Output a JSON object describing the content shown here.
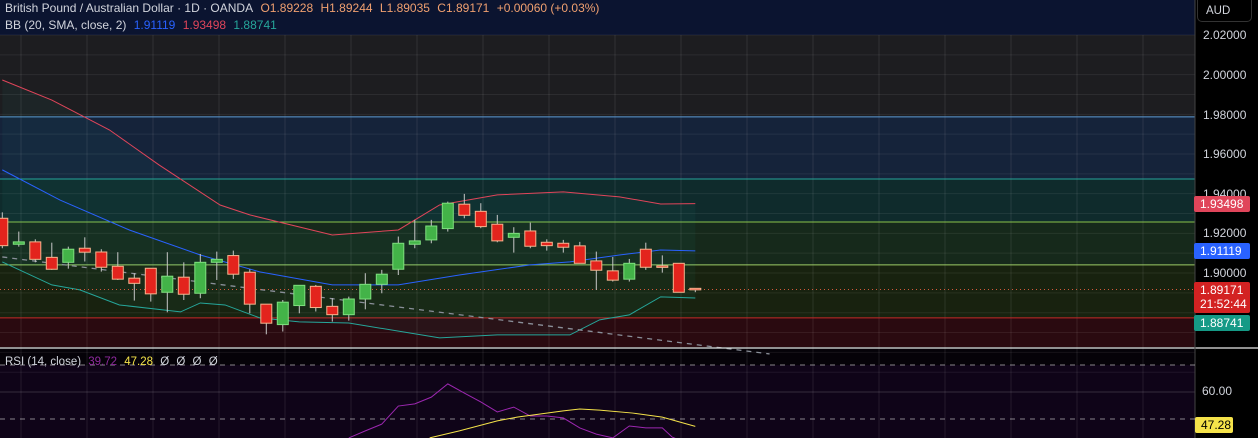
{
  "header": {
    "symbol": "British Pound / Australian Dollar · 1D · OANDA",
    "open": "O1.89228",
    "high": "H1.89244",
    "low": "L1.89035",
    "close": "C1.89171",
    "change": "+0.00060 (+0.03%)"
  },
  "bb_legend": {
    "label": "BB (20, SMA, close, 2)",
    "basis": "1.91119",
    "upper": "1.93498",
    "lower": "1.88741"
  },
  "rsi_legend": {
    "label": "RSI (14, close)",
    "rsi": "39.72",
    "ma": "47.28",
    "extra": [
      "Ø",
      "Ø",
      "Ø",
      "Ø"
    ]
  },
  "axis": {
    "currency": "AUD",
    "ticks": [
      "2.02000",
      "2.00000",
      "1.98000",
      "1.96000",
      "1.94000",
      "1.92000",
      "1.90000"
    ],
    "tick_values": [
      2.02,
      2.0,
      1.98,
      1.96,
      1.94,
      1.92,
      1.9
    ],
    "upper_tag": "1.93498",
    "basis_tag": "1.91119",
    "price_tag": "1.89171",
    "countdown": "21:52:44",
    "lower_tag": "1.88741",
    "rsi_tick": "60.00",
    "rsi_tag": "47.28"
  },
  "colors": {
    "up": "#43b348",
    "down": "#e3241d",
    "upper": "#e0455a",
    "basis": "#2962ff",
    "lower": "#26a69a",
    "rsi": "#9c27b0",
    "rsi_ma": "#f5e34a"
  },
  "chart_data": {
    "type": "candlestick",
    "price_range": [
      1.8435,
      2.0305
    ],
    "current_price": 1.89171,
    "levels": [
      1.9787,
      1.9474,
      1.9257,
      1.9041,
      1.8774
    ],
    "ohlc": [
      [
        1.9276,
        1.9306,
        1.9125,
        1.9138
      ],
      [
        1.9145,
        1.9209,
        1.9133,
        1.9157
      ],
      [
        1.9157,
        1.917,
        1.9054,
        1.9069
      ],
      [
        1.9079,
        1.9153,
        1.9016,
        1.9019
      ],
      [
        1.9054,
        1.9133,
        1.9022,
        1.912
      ],
      [
        1.9125,
        1.918,
        1.9058,
        1.9105
      ],
      [
        1.9106,
        1.912,
        1.9007,
        1.9029
      ],
      [
        1.9034,
        1.9105,
        1.8965,
        1.8969
      ],
      [
        1.8974,
        1.8999,
        1.8861,
        1.8948
      ],
      [
        1.9024,
        1.9024,
        1.8856,
        1.8895
      ],
      [
        1.8903,
        1.9105,
        1.8802,
        1.8984
      ],
      [
        1.8979,
        1.9054,
        1.8864,
        1.8893
      ],
      [
        1.8898,
        1.9096,
        1.8873,
        1.9054
      ],
      [
        1.9054,
        1.9108,
        1.8965,
        1.9069
      ],
      [
        1.9088,
        1.9113,
        1.897,
        1.8994
      ],
      [
        1.9004,
        1.9019,
        1.8797,
        1.8843
      ],
      [
        1.8843,
        1.8843,
        1.8691,
        1.8747
      ],
      [
        1.874,
        1.8864,
        1.8705,
        1.8853
      ],
      [
        1.8836,
        1.8938,
        1.8797,
        1.8938
      ],
      [
        1.8933,
        1.894,
        1.8806,
        1.8826
      ],
      [
        1.8832,
        1.8873,
        1.8755,
        1.879
      ],
      [
        1.879,
        1.8881,
        1.876,
        1.8869
      ],
      [
        1.8869,
        1.8999,
        1.8817,
        1.8943
      ],
      [
        1.8943,
        1.9016,
        1.8898,
        1.8994
      ],
      [
        1.9019,
        1.9184,
        1.899,
        1.915
      ],
      [
        1.9145,
        1.9268,
        1.9125,
        1.9162
      ],
      [
        1.9167,
        1.9268,
        1.915,
        1.9237
      ],
      [
        1.9224,
        1.936,
        1.9209,
        1.9352
      ],
      [
        1.9347,
        1.9399,
        1.9276,
        1.9291
      ],
      [
        1.9311,
        1.9352,
        1.9226,
        1.9234
      ],
      [
        1.9246,
        1.9293,
        1.9155,
        1.9162
      ],
      [
        1.918,
        1.9231,
        1.9103,
        1.92
      ],
      [
        1.9212,
        1.9254,
        1.9125,
        1.9135
      ],
      [
        1.9155,
        1.917,
        1.9113,
        1.9138
      ],
      [
        1.915,
        1.9167,
        1.9103,
        1.913
      ],
      [
        1.9137,
        1.9157,
        1.9049,
        1.9049
      ],
      [
        1.9061,
        1.9108,
        1.8915,
        1.9014
      ],
      [
        1.9011,
        1.9081,
        1.8957,
        1.8964
      ],
      [
        1.8969,
        1.9071,
        1.8957,
        1.9049
      ],
      [
        1.912,
        1.9153,
        1.9016,
        1.9029
      ],
      [
        1.9036,
        1.9089,
        1.9002,
        1.9031
      ],
      [
        1.9049,
        1.9049,
        1.8903,
        1.8903
      ],
      [
        1.89228,
        1.89244,
        1.89035,
        1.89171
      ]
    ],
    "bb_upper": [
      [
        0,
        1.9973
      ],
      [
        3,
        1.9872
      ],
      [
        6.5,
        1.9721
      ],
      [
        9.5,
        1.9545
      ],
      [
        13.2,
        1.9343
      ],
      [
        15,
        1.9293
      ],
      [
        20,
        1.9192
      ],
      [
        24,
        1.9217
      ],
      [
        26.5,
        1.9343
      ],
      [
        30,
        1.9394
      ],
      [
        34,
        1.9409
      ],
      [
        37.4,
        1.9384
      ],
      [
        39.9,
        1.9348
      ],
      [
        42,
        1.93498
      ]
    ],
    "bb_basis": [
      [
        0,
        1.952
      ],
      [
        3.5,
        1.9368
      ],
      [
        7.7,
        1.9217
      ],
      [
        12,
        1.9091
      ],
      [
        15.6,
        1.9006
      ],
      [
        20,
        1.894
      ],
      [
        24,
        1.894
      ],
      [
        27.7,
        1.899
      ],
      [
        32,
        1.9041
      ],
      [
        34.4,
        1.9056
      ],
      [
        37.4,
        1.9091
      ],
      [
        39.9,
        1.9116
      ],
      [
        42,
        1.91119
      ]
    ],
    "bb_lower": [
      [
        0,
        1.9056
      ],
      [
        3,
        1.894
      ],
      [
        4.7,
        1.8915
      ],
      [
        7.1,
        1.8839
      ],
      [
        10.8,
        1.8804
      ],
      [
        12,
        1.8849
      ],
      [
        13.5,
        1.8839
      ],
      [
        15.6,
        1.8774
      ],
      [
        18,
        1.8754
      ],
      [
        21,
        1.8748
      ],
      [
        26.5,
        1.8673
      ],
      [
        30,
        1.8688
      ],
      [
        34.4,
        1.8688
      ],
      [
        36.2,
        1.8764
      ],
      [
        38,
        1.8789
      ],
      [
        39.9,
        1.888
      ],
      [
        42,
        1.88741
      ]
    ],
    "trendline": [
      [
        0,
        1.9081
      ],
      [
        46.5,
        1.8592
      ]
    ],
    "rsi_range": [
      36.6,
      73.0
    ],
    "rsi_levels": [
      70,
      50
    ],
    "rsi": [
      [
        21,
        43
      ],
      [
        22,
        45.6
      ],
      [
        23,
        48.1
      ],
      [
        24,
        54.8
      ],
      [
        25,
        55.6
      ],
      [
        26,
        58.1
      ],
      [
        27,
        63
      ],
      [
        28,
        59.6
      ],
      [
        29,
        56.3
      ],
      [
        30,
        52.6
      ],
      [
        31,
        54.4
      ],
      [
        32,
        51.1
      ],
      [
        33,
        51.1
      ],
      [
        34,
        50.4
      ],
      [
        35,
        46.7
      ],
      [
        36,
        44.4
      ],
      [
        37,
        43
      ],
      [
        38,
        47.4
      ],
      [
        39,
        46.7
      ],
      [
        40,
        46.7
      ],
      [
        40.6,
        43.3
      ],
      [
        42,
        39.72
      ]
    ],
    "rsi_ma": [
      [
        25.9,
        43
      ],
      [
        27.7,
        45.6
      ],
      [
        30,
        49.3
      ],
      [
        31.2,
        50.7
      ],
      [
        34,
        53
      ],
      [
        35,
        53.7
      ],
      [
        36.2,
        53.3
      ],
      [
        38.2,
        52.2
      ],
      [
        40,
        50.7
      ],
      [
        42,
        47.28
      ]
    ]
  }
}
